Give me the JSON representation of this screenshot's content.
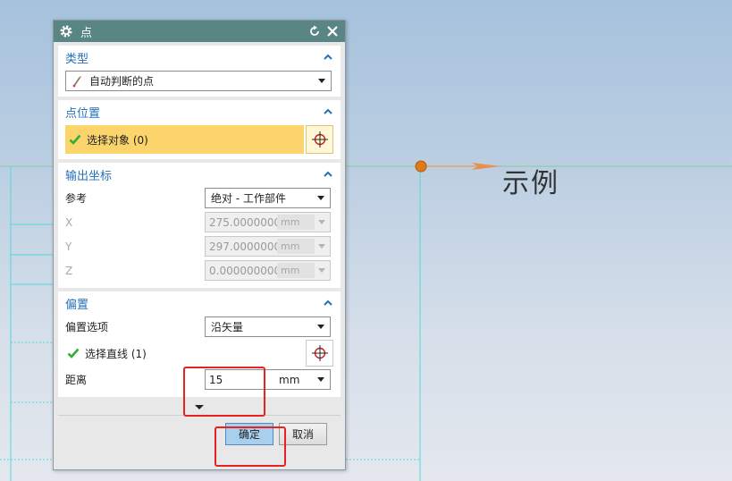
{
  "dialog": {
    "title": "点",
    "type_section": {
      "header": "类型",
      "selected_type": "自动判断的点"
    },
    "position_section": {
      "header": "点位置",
      "select_object": "选择对象 (0)"
    },
    "output_section": {
      "header": "输出坐标",
      "reference_label": "参考",
      "reference_value": "绝对 - 工作部件",
      "x_label": "X",
      "x_value": "275.0000000000",
      "x_unit": "mm",
      "y_label": "Y",
      "y_value": "297.0000000000",
      "y_unit": "mm",
      "z_label": "Z",
      "z_value": "0.0000000000",
      "z_unit": "mm"
    },
    "offset_section": {
      "header": "偏置",
      "option_label": "偏置选项",
      "option_value": "沿矢量",
      "select_line": "选择直线 (1)",
      "distance_label": "距离",
      "distance_value": "15",
      "distance_unit": "mm"
    },
    "ok_label": "确定",
    "cancel_label": "取消"
  },
  "viewport": {
    "annotation_text": "示例"
  },
  "colors": {
    "titlebar": "#5a8585",
    "section_header": "#2570b8",
    "selection_highlight": "#fcd46c",
    "check": "#2eae3a",
    "point": "#e07a18",
    "ok_button": "#a8d0ee",
    "red_callout": "#e62222",
    "construction_lines": "#4fd9d9"
  },
  "icons": [
    "gear-icon",
    "reset-icon",
    "close-icon",
    "chevron-up-icon",
    "point-type-icon",
    "check-icon",
    "point-crosshair-icon",
    "dropdown-arrow-icon",
    "expand-more-icon"
  ]
}
